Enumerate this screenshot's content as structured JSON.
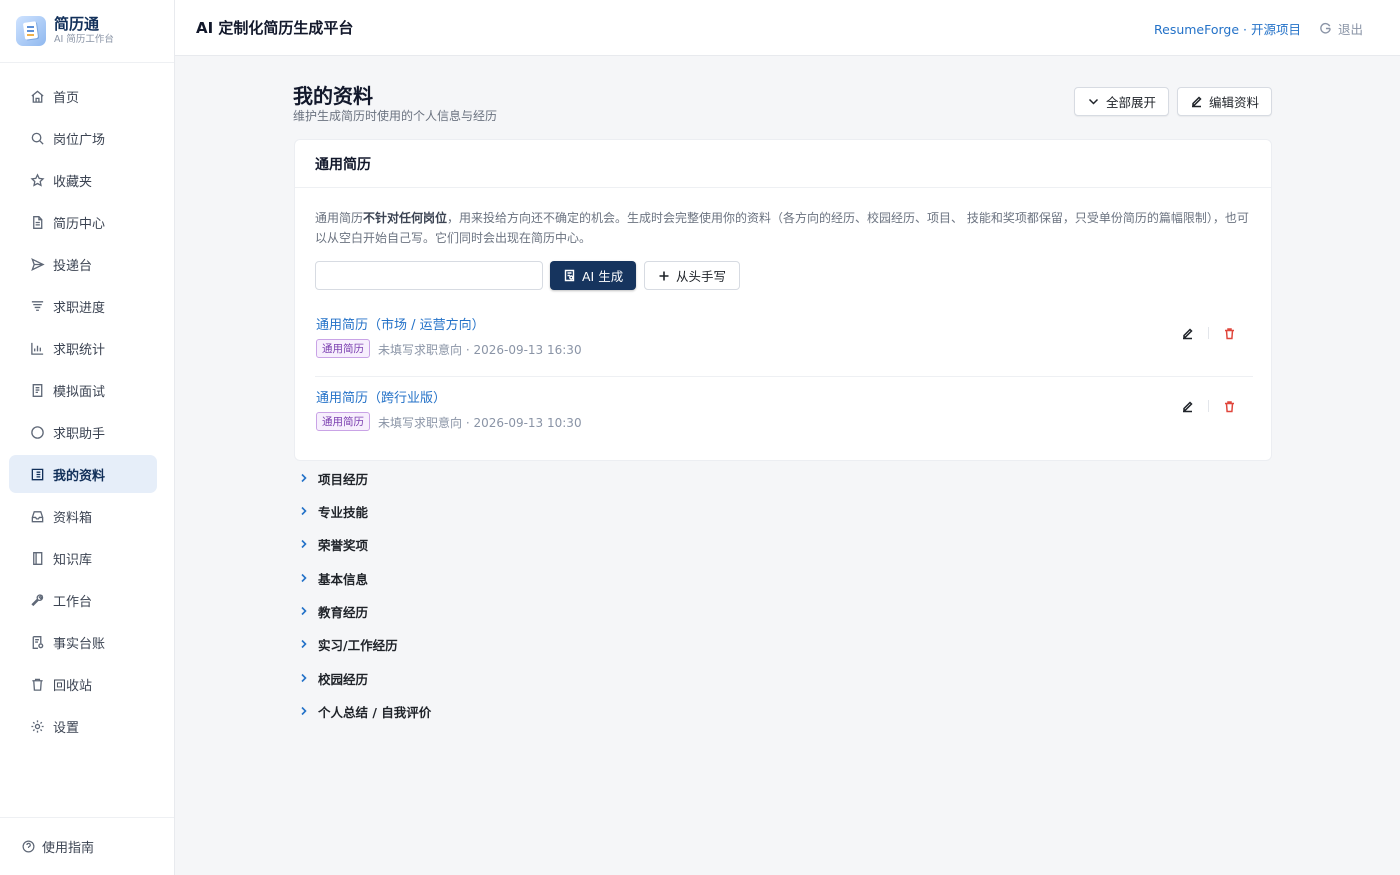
{
  "brand": {
    "name": "简历通",
    "subtitle": "AI 简历工作台"
  },
  "sidebar": {
    "items": [
      {
        "label": "首页",
        "icon": "home-icon"
      },
      {
        "label": "岗位广场",
        "icon": "search-icon"
      },
      {
        "label": "收藏夹",
        "icon": "star-icon"
      },
      {
        "label": "简历中心",
        "icon": "file-icon"
      },
      {
        "label": "投递台",
        "icon": "send-icon"
      },
      {
        "label": "求职进度",
        "icon": "funnel-icon"
      },
      {
        "label": "求职统计",
        "icon": "bar-chart-icon"
      },
      {
        "label": "模拟面试",
        "icon": "interview-doc-icon"
      },
      {
        "label": "求职助手",
        "icon": "chat-bubble-icon"
      },
      {
        "label": "我的资料",
        "icon": "profile-list-icon",
        "active": true
      },
      {
        "label": "资料箱",
        "icon": "inbox-icon"
      },
      {
        "label": "知识库",
        "icon": "book-icon"
      },
      {
        "label": "工作台",
        "icon": "wrench-icon"
      },
      {
        "label": "事实台账",
        "icon": "ledger-icon"
      },
      {
        "label": "回收站",
        "icon": "trash-icon"
      },
      {
        "label": "设置",
        "icon": "gear-icon"
      }
    ],
    "guide_label": "使用指南"
  },
  "header": {
    "title": "AI 定制化简历生成平台",
    "repo_link": "ResumeForge · 开源项目",
    "logout_label": "退出"
  },
  "page": {
    "title": "我的资料",
    "subtitle": "维护生成简历时使用的个人信息与经历",
    "expand_all_label": "全部展开",
    "edit_profile_label": "编辑资料"
  },
  "general_resume": {
    "heading": "通用简历",
    "description_prefix": "通用简历",
    "description_bold": "不针对任何岗位",
    "description_rest": "，用来投给方向还不确定的机会。生成时会完整使用你的资料（各方向的经历、校园经历、项目、 技能和奖项都保留，只受单份简历的篇幅限制），也可以从空白开始自己写。它们同时会出现在简历中心。",
    "name_input_value": "",
    "name_input_placeholder": "",
    "ai_generate_label": "AI 生成",
    "write_from_scratch_label": "从头手写",
    "resumes": [
      {
        "title": "通用简历（市场 / 运营方向）",
        "tag": "通用简历",
        "meta": "未填写求职意向 · 2026-09-13 16:30"
      },
      {
        "title": "通用简历（跨行业版）",
        "tag": "通用简历",
        "meta": "未填写求职意向 · 2026-09-13 10:30"
      }
    ]
  },
  "sections": [
    "项目经历",
    "专业技能",
    "荣誉奖项",
    "基本信息",
    "教育经历",
    "实习/工作经历",
    "校园经历",
    "个人总结 / 自我评价"
  ],
  "colors": {
    "accent": "#16345e",
    "link": "#2472c8",
    "active_nav_bg": "#e6eef9",
    "tag_purple": "#7b3fb0",
    "delete_red": "#e0463c"
  }
}
